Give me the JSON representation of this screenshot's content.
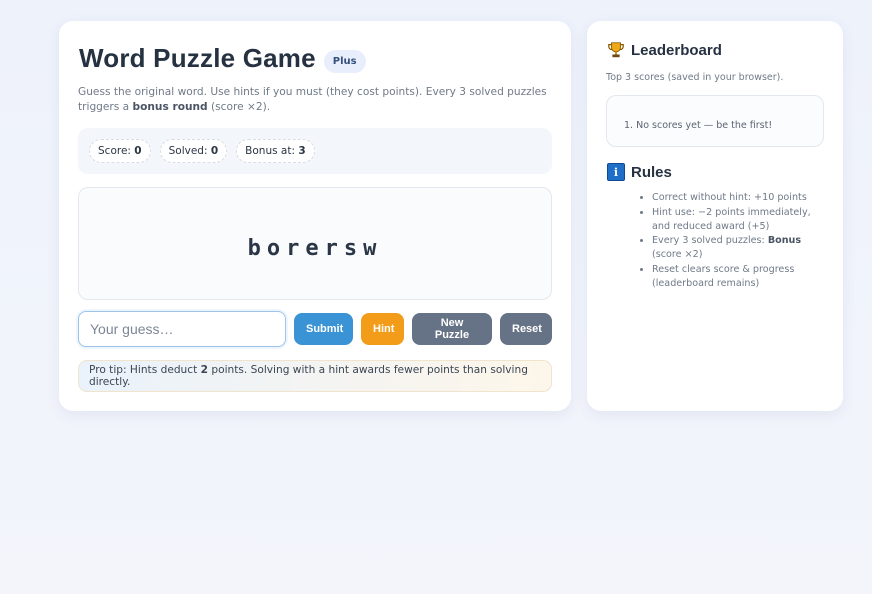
{
  "game": {
    "title": "Word Puzzle Game",
    "badge": "Plus",
    "subtitle_pre": "Guess the original word. Use hints if you must (they cost points). Every 3 solved puzzles triggers a ",
    "subtitle_bold": "bonus round",
    "subtitle_post": " (score ×2).",
    "stats": {
      "score_label": "Score:",
      "score_value": "0",
      "solved_label": "Solved:",
      "solved_value": "0",
      "bonus_label": "Bonus at:",
      "bonus_value": "3"
    },
    "scrambled_word": "borersw",
    "guess_input": {
      "value": "",
      "placeholder": "Your guess…"
    },
    "buttons": {
      "submit": "Submit",
      "hint": "Hint",
      "new_puzzle": "New Puzzle",
      "reset": "Reset"
    },
    "tip_pre": "Pro tip: Hints deduct ",
    "tip_bold": "2",
    "tip_post": " points. Solving with a hint awards fewer points than solving directly."
  },
  "leaderboard": {
    "title": "Leaderboard",
    "icon": "trophy-icon",
    "subtitle": "Top 3 scores (saved in your browser).",
    "entries": [
      "1. No scores yet — be the first!"
    ]
  },
  "rules": {
    "title": "Rules",
    "icon": "info-icon",
    "items": [
      "Correct without hint: +10 points",
      "Hint use: −2 points immediately, and reduced award (+5)",
      "Every 3 solved puzzles: ",
      "Reset clears score & progress (leaderboard remains)"
    ],
    "item3_bold": "Bonus",
    "item3_post": " (score ×2)"
  },
  "colors": {
    "accent_blue": "#3a93d4",
    "accent_orange": "#f29c1a",
    "neutral_button": "#667286"
  }
}
